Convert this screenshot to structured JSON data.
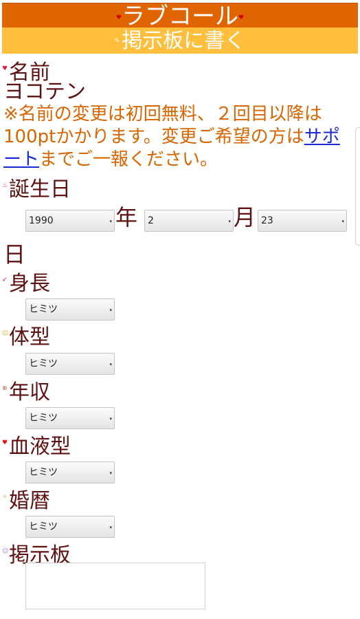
{
  "header": {
    "title": "ラブコール",
    "subtitle": "掲示板に書く",
    "title_icon": "heart-icon"
  },
  "form": {
    "name": {
      "label": "名前",
      "value": "ヨコテン"
    },
    "note": {
      "before": "※名前の変更は初回無料、２回目以降は100ptかかります。変更ご希望の方は",
      "link": "サポート",
      "after": "までご一報ください。"
    },
    "birthday": {
      "label": "誕生日",
      "year": "1990",
      "year_unit": "年",
      "month": "2",
      "month_unit": "月",
      "day": "23",
      "day_unit": "日"
    },
    "height": {
      "label": "身長",
      "value": "ヒミツ"
    },
    "body_type": {
      "label": "体型",
      "value": "ヒミツ"
    },
    "income": {
      "label": "年収",
      "value": "ヒミツ"
    },
    "blood_type": {
      "label": "血液型",
      "value": "ヒミツ"
    },
    "marital": {
      "label": "婚暦",
      "value": "ヒミツ"
    },
    "board": {
      "label": "掲示板",
      "value": ""
    }
  },
  "colors": {
    "header_top": "#e06500",
    "header_sub": "#ffbe3b",
    "label_text": "#5e0f0f",
    "note_text": "#d86500",
    "link": "#1a2ad8"
  }
}
